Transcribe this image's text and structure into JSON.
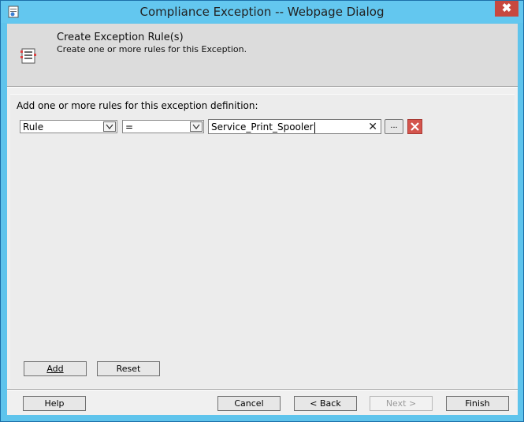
{
  "window": {
    "title": "Compliance Exception -- Webpage Dialog",
    "close_glyph": "✖"
  },
  "header": {
    "title": "Create Exception Rule(s)",
    "subtitle": "Create one or more rules for this Exception.",
    "icon": "rules-icon"
  },
  "main": {
    "instruction": "Add one or more rules for this exception definition:",
    "rule_row": {
      "field_select": "Rule",
      "operator_select": "=",
      "value_input": "Service_Print_Spooler",
      "clear_glyph": "✕",
      "browse_label": "..."
    },
    "add_label": "Add",
    "reset_label": "Reset"
  },
  "footer": {
    "help_label": "Help",
    "cancel_label": "Cancel",
    "back_label": "< Back",
    "next_label": "Next >",
    "finish_label": "Finish"
  },
  "colors": {
    "titlebar": "#63c7ef",
    "delete": "#d4554d"
  }
}
